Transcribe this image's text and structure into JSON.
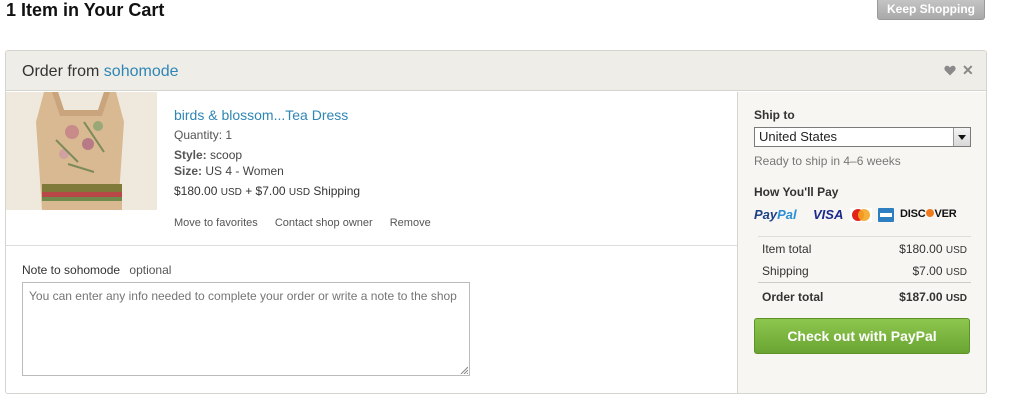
{
  "page": {
    "title": "1 Item in Your Cart",
    "keep_shopping_label": "Keep Shopping"
  },
  "order": {
    "header_prefix": "Order from",
    "shop_name": "sohomode",
    "item": {
      "title": "birds & blossom...Tea Dress",
      "quantity": "Quantity: 1",
      "style_label": "Style:",
      "style_value": "scoop",
      "size_label": "Size:",
      "size_value": "US 4 - Women",
      "price": "$180.00",
      "price_currency": "USD",
      "shipping_prefix": "+ $7.00",
      "shipping_currency": "USD",
      "shipping_suffix": "Shipping",
      "image_description": "product-photo-floral-dress"
    },
    "actions": {
      "favorites": "Move to favorites",
      "contact": "Contact shop owner",
      "remove": "Remove"
    },
    "note": {
      "label": "Note to sohomode",
      "optional": "optional",
      "placeholder": "You can enter any info needed to complete your order or write a note to the shop"
    }
  },
  "sidebar": {
    "ship_to_label": "Ship to",
    "country_selected": "United States",
    "ready_text": "Ready to ship in 4–6 weeks",
    "how_pay_label": "How You'll Pay",
    "payment_methods": {
      "paypal_a": "Pay",
      "paypal_b": "Pal",
      "visa": "VISA",
      "discover_a": "DISC",
      "discover_b": "VER"
    },
    "totals": {
      "item_total_label": "Item total",
      "item_total_value": "$180.00",
      "shipping_label": "Shipping",
      "shipping_value": "$7.00",
      "order_total_label": "Order total",
      "order_total_value": "$187.00",
      "currency": "USD"
    },
    "checkout_label": "Check out with PayPal"
  },
  "colors": {
    "link": "#2f86b4",
    "checkout_green": "#77b23d",
    "header_bg": "#eeede8",
    "sidebar_bg": "#f7f6f2"
  }
}
